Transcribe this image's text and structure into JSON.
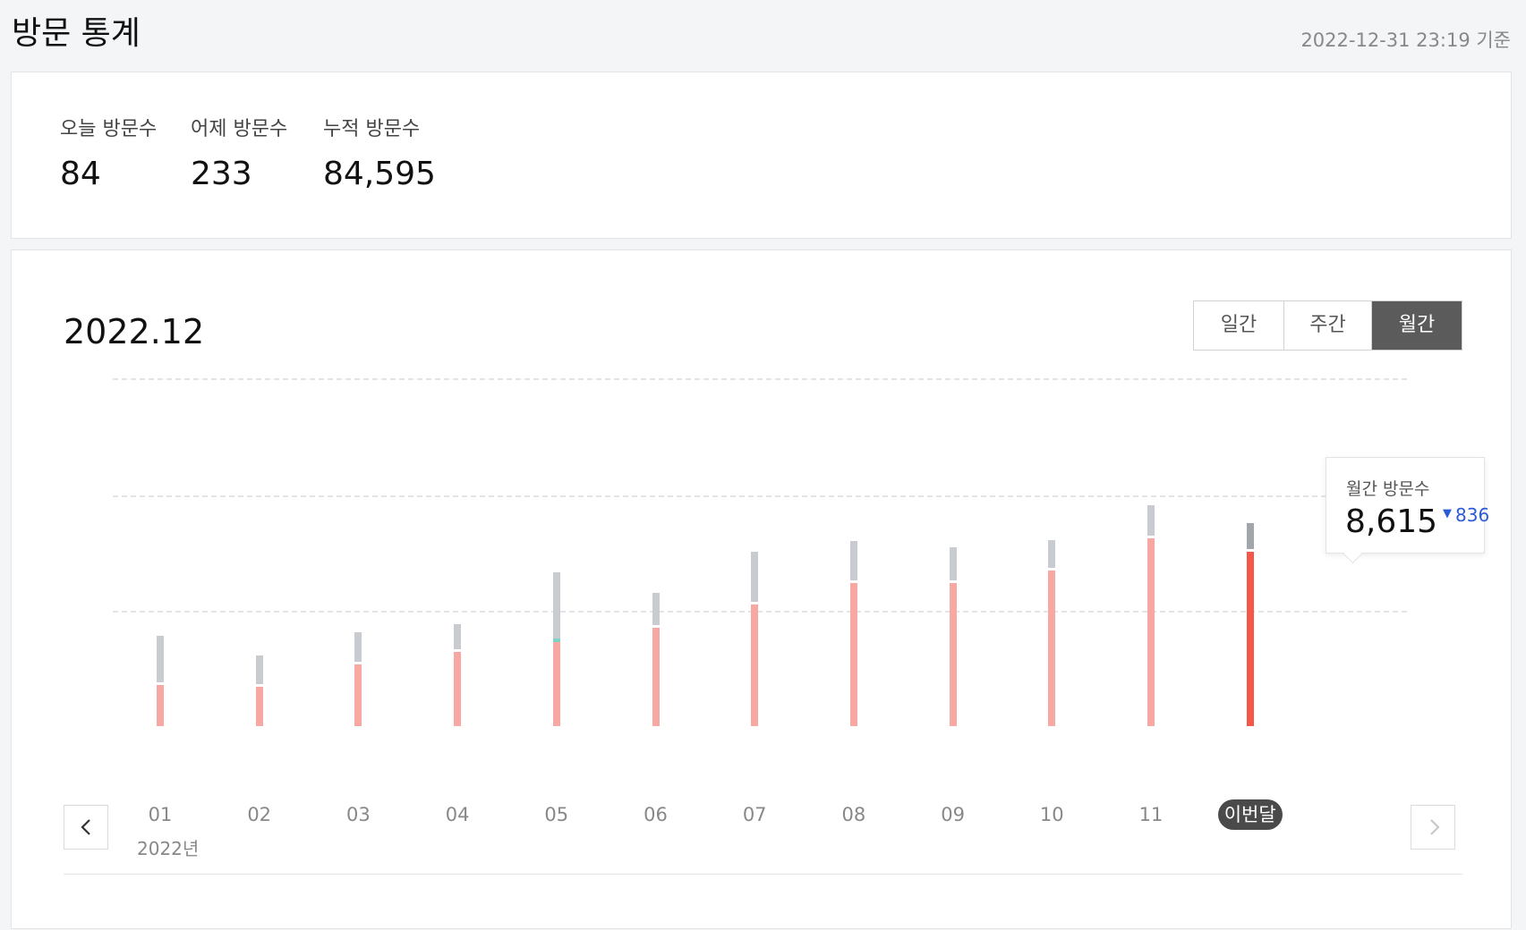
{
  "header": {
    "title": "방문 통계",
    "updated_at": "2022-12-31 23:19 기준"
  },
  "summary": {
    "today": {
      "label": "오늘 방문수",
      "value": "84"
    },
    "yesterday": {
      "label": "어제 방문수",
      "value": "233"
    },
    "total": {
      "label": "누적 방문수",
      "value": "84,595"
    }
  },
  "chart_panel": {
    "period": "2022.12",
    "tabs": [
      {
        "label": "일간",
        "active": false
      },
      {
        "label": "주간",
        "active": false
      },
      {
        "label": "월간",
        "active": true
      }
    ],
    "year_label": "2022년",
    "tooltip": {
      "label": "월간 방문수",
      "value": "8,615",
      "change": "836",
      "change_direction": "down"
    }
  },
  "chart_data": {
    "type": "bar",
    "categories": [
      "01",
      "02",
      "03",
      "04",
      "05",
      "06",
      "07",
      "08",
      "09",
      "10",
      "11",
      "이번달"
    ],
    "series": [
      {
        "values": [
          2050,
          1950,
          3050,
          3650,
          4150,
          4850,
          6000,
          7050,
          7050,
          7700,
          9300,
          8615
        ],
        "color": "#f7a8a2"
      },
      {
        "values": [
          2300,
          1400,
          1450,
          1250,
          3300,
          1600,
          2500,
          1950,
          1650,
          1350,
          1500,
          1300
        ],
        "color": "#c8cbcf"
      }
    ],
    "highlight_color": "#f5574b",
    "highlight_cap_color": "#a1a6ad",
    "ylim": [
      0,
      17500
    ],
    "gridlines": [
      5700,
      11400,
      17200
    ],
    "grid": true,
    "legend": "none"
  },
  "colors": {
    "background": "#f4f5f7",
    "accent": "#f5574b",
    "change_down": "#2a5bd7",
    "active_tab": "#5b5b5b"
  },
  "icons": {
    "prev": "chevron-left-icon",
    "next": "chevron-right-icon",
    "change": "triangle-down-icon"
  }
}
